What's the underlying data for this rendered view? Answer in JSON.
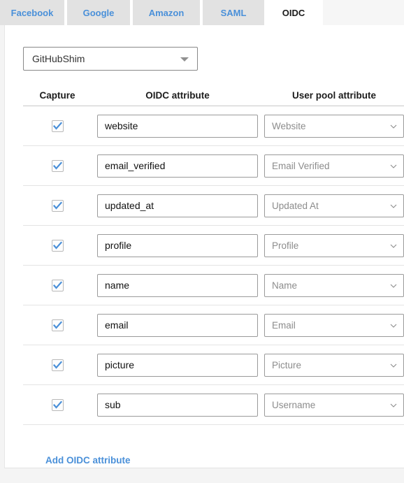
{
  "tabs": [
    {
      "label": "Facebook",
      "active": false
    },
    {
      "label": "Google",
      "active": false
    },
    {
      "label": "Amazon",
      "active": false
    },
    {
      "label": "SAML",
      "active": false
    },
    {
      "label": "OIDC",
      "active": true
    }
  ],
  "provider": {
    "selected": "GitHubShim",
    "icon": "chevron-down-icon"
  },
  "table": {
    "headers": {
      "capture": "Capture",
      "oidc_attribute": "OIDC attribute",
      "user_pool_attribute": "User pool attribute"
    },
    "rows": [
      {
        "captured": true,
        "oidc_attribute": "website",
        "user_pool_attribute": "Website"
      },
      {
        "captured": true,
        "oidc_attribute": "email_verified",
        "user_pool_attribute": "Email Verified"
      },
      {
        "captured": true,
        "oidc_attribute": "updated_at",
        "user_pool_attribute": "Updated At"
      },
      {
        "captured": true,
        "oidc_attribute": "profile",
        "user_pool_attribute": "Profile"
      },
      {
        "captured": true,
        "oidc_attribute": "name",
        "user_pool_attribute": "Name"
      },
      {
        "captured": true,
        "oidc_attribute": "email",
        "user_pool_attribute": "Email"
      },
      {
        "captured": true,
        "oidc_attribute": "picture",
        "user_pool_attribute": "Picture"
      },
      {
        "captured": true,
        "oidc_attribute": "sub",
        "user_pool_attribute": "Username"
      }
    ]
  },
  "actions": {
    "add_attribute_label": "Add OIDC attribute"
  },
  "colors": {
    "link": "#4a90d9",
    "tab_inactive_bg": "#e2e2e2",
    "tab_active_bg": "#ffffff",
    "checkbox_check": "#4a90d9",
    "placeholder_text": "#8c8c8c"
  }
}
